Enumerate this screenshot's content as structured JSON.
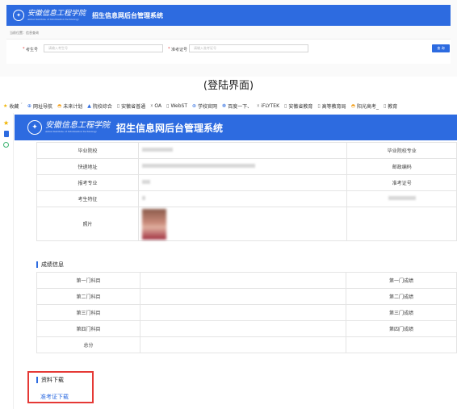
{
  "login": {
    "brand_cn": "安徽信息工程学院",
    "brand_en": "Anhui Institute of Information Technology",
    "system_title": "招生信息网后台管理系统",
    "breadcrumb": "当前位置：信息查询",
    "exam_no_label": "考生号",
    "exam_no_placeholder": "请输入考生号",
    "admit_no_label": "准考证号",
    "admit_no_placeholder": "请输入准考证号",
    "query_button": "查 询"
  },
  "caption": "(登陆界面)",
  "bookmarks": [
    {
      "icon": "★",
      "label": "收藏",
      "color": "#f0b400"
    },
    {
      "icon": "⊕",
      "label": "网址导航",
      "color": "#2d6be0"
    },
    {
      "icon": "◓",
      "label": "未来计划",
      "color": "#f39c12"
    },
    {
      "icon": "▲",
      "label": "院校综合",
      "color": "#2d6be0"
    },
    {
      "icon": "▯",
      "label": "安徽省普通",
      "color": "#777"
    },
    {
      "icon": "☓",
      "label": "OA",
      "color": "#555"
    },
    {
      "icon": "▯",
      "label": "WebST",
      "color": "#777"
    },
    {
      "icon": "⊛",
      "label": "学校官网",
      "color": "#2d6be0"
    },
    {
      "icon": "❁",
      "label": "百度一下、",
      "color": "#2d6be0"
    },
    {
      "icon": "☓",
      "label": "iFLYTEK",
      "color": "#555"
    },
    {
      "icon": "▯",
      "label": "安徽省教育",
      "color": "#777"
    },
    {
      "icon": "▯",
      "label": "高等教育局",
      "color": "#777"
    },
    {
      "icon": "◓",
      "label": "阳光高考_",
      "color": "#f39c12"
    },
    {
      "icon": "▯",
      "label": "教育",
      "color": "#777"
    }
  ],
  "main": {
    "brand_cn": "安徽信息工程学院",
    "brand_en": "Anhui Institute of Information Technology",
    "system_title": "招生信息网后台管理系统",
    "info_rows": [
      {
        "label": "毕业院校",
        "right": "毕业院校专业"
      },
      {
        "label": "快递地址",
        "right": "邮政编码"
      },
      {
        "label": "报考专业",
        "right": "准考证号"
      },
      {
        "label": "考生特征",
        "right": ""
      },
      {
        "label": "照片",
        "right": ""
      }
    ],
    "score_title": "成绩信息",
    "score_rows": [
      {
        "label": "第一门科目",
        "right": "第一门成绩"
      },
      {
        "label": "第二门科目",
        "right": "第二门成绩"
      },
      {
        "label": "第三门科目",
        "right": "第三门成绩"
      },
      {
        "label": "第四门科目",
        "right": "第四门成绩"
      },
      {
        "label": "总分",
        "right": ""
      }
    ],
    "download_title": "资料下载",
    "download_link": "准考证下载"
  },
  "colors": {
    "header_blue": "#2d6be0",
    "highlight_red": "#e53935"
  }
}
